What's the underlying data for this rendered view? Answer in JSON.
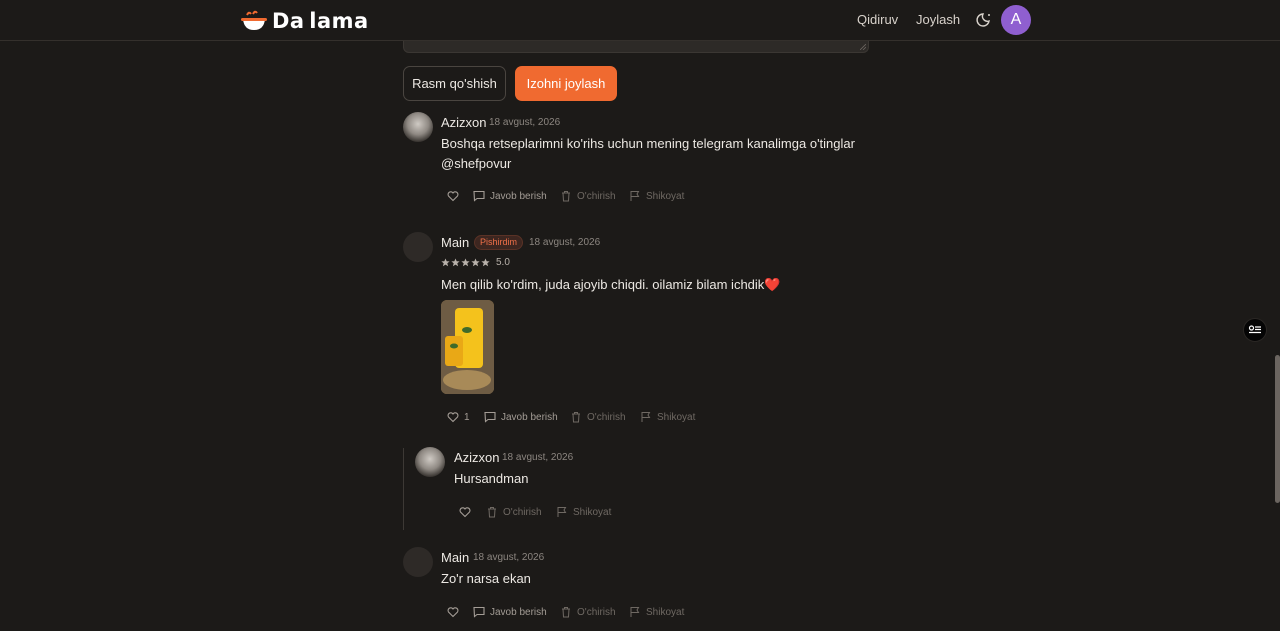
{
  "header": {
    "logo_text": "Da lama",
    "nav": {
      "search": "Qidiruv",
      "post": "Joylash"
    },
    "avatar_letter": "A"
  },
  "composer": {
    "add_photo_label": "Rasm qo'shish",
    "submit_label": "Izohni joylash"
  },
  "comments": [
    {
      "author": "Azizxon",
      "date": "18 avgust, 2026",
      "text_line1": "Boshqa retseplarimni ko'rihs uchun mening telegram kanalimga o'tinglar",
      "text_line2": "@shefpovur",
      "actions": {
        "reply": "Javob berish",
        "delete": "O'chirish",
        "report": "Shikoyat"
      }
    },
    {
      "author": "Main",
      "badge": "Pishirdim",
      "date": "18 avgust, 2026",
      "rating": "5.0",
      "rating_value": 5,
      "text": "Men qilib ko'rdim, juda ajoyib chiqdi. oilamiz bilam ichdik",
      "emoji": "❤️",
      "likes": "1",
      "actions": {
        "reply": "Javob berish",
        "delete": "O'chirish",
        "report": "Shikoyat"
      }
    },
    {
      "author": "Azizxon",
      "date": "18 avgust, 2026",
      "text": "Hursandman",
      "actions": {
        "delete": "O'chirish",
        "report": "Shikoyat"
      }
    },
    {
      "author": "Main",
      "date": "18 avgust, 2026",
      "text": "Zo'r narsa ekan",
      "actions": {
        "reply": "Javob berish",
        "delete": "O'chirish",
        "report": "Shikoyat"
      }
    }
  ],
  "colors": {
    "accent": "#f06a30",
    "background": "#1c1a18",
    "avatar": "#8f5fd0",
    "badge": "#f07048"
  }
}
